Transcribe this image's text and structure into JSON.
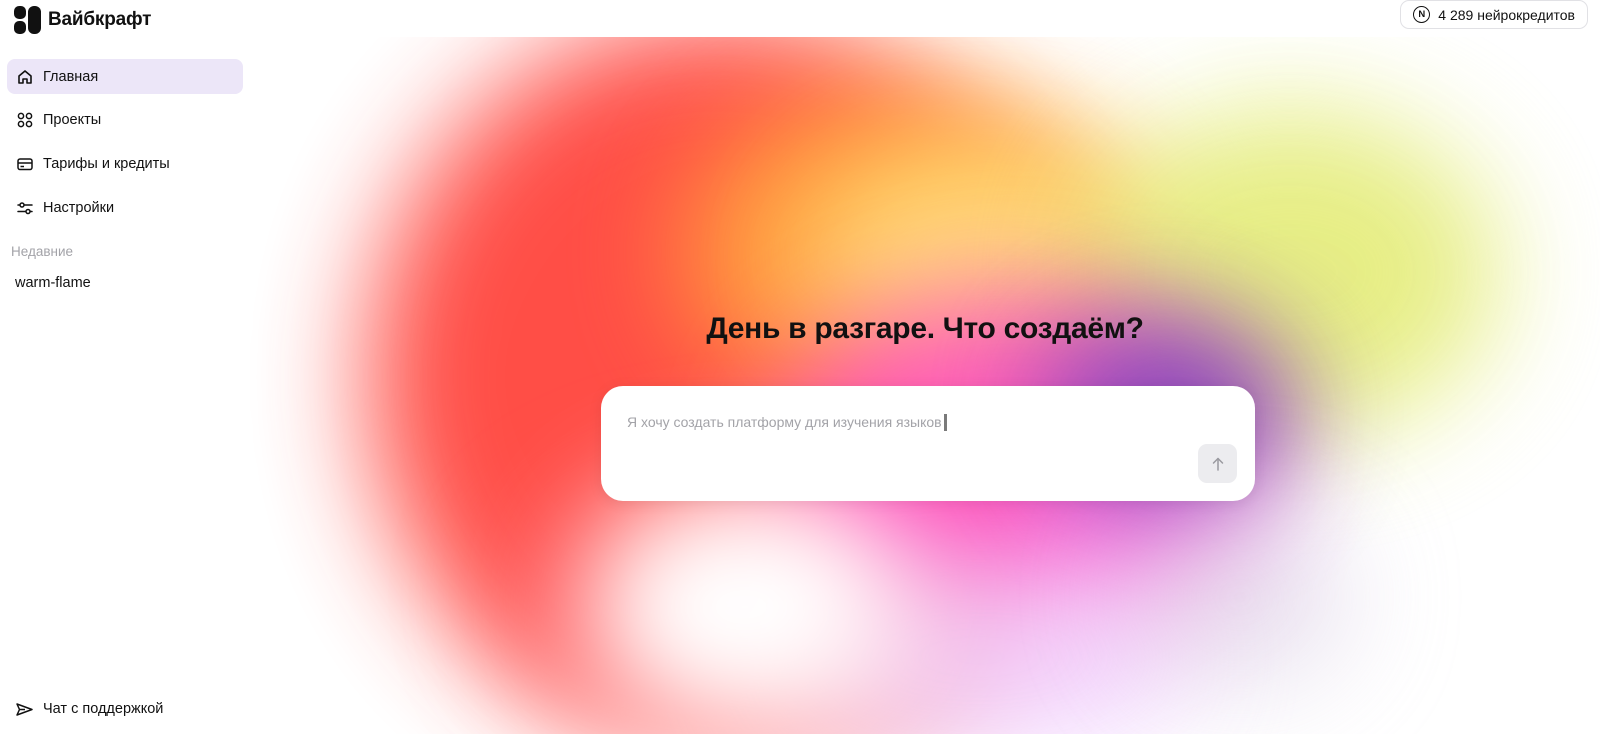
{
  "app": {
    "name": "Вайбкрафт"
  },
  "sidebar": {
    "items": [
      {
        "label": "Главная",
        "icon": "home-icon",
        "active": true
      },
      {
        "label": "Проекты",
        "icon": "grid-dots-icon",
        "active": false
      },
      {
        "label": "Тарифы и кредиты",
        "icon": "credit-card-icon",
        "active": false
      },
      {
        "label": "Настройки",
        "icon": "sliders-icon",
        "active": false
      }
    ],
    "recent_title": "Недавние",
    "recent": [
      {
        "label": "warm-flame"
      }
    ],
    "support_label": "Чат с поддержкой",
    "support_icon": "paper-plane-icon"
  },
  "header": {
    "credits_badge": "N",
    "credits_label": "4 289 нейрокредитов"
  },
  "main": {
    "headline": "День в разгаре. Что создаём?",
    "input_placeholder": "Я хочу создать платформу для изучения языков",
    "send_icon": "arrow-up-icon"
  },
  "colors": {
    "active_nav_bg": "#ece6f8",
    "muted_text": "#a3a3a8",
    "send_button_bg": "#ececef",
    "gradient": [
      "#ff3b33",
      "#ffa23d",
      "#ffe07a",
      "#e4ec78",
      "#7e3fb8",
      "#ff4fd2",
      "#f0d4ff"
    ]
  }
}
